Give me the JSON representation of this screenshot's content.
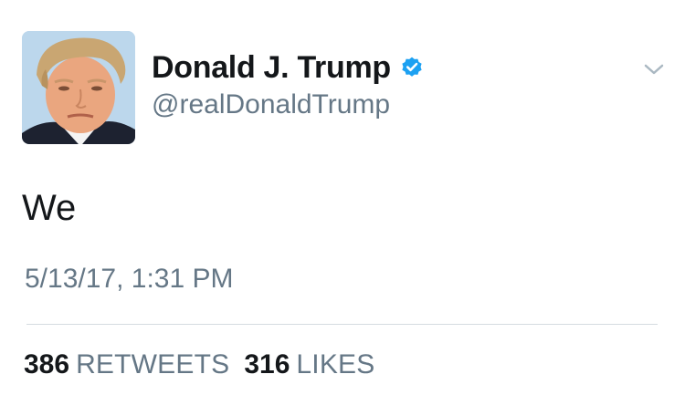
{
  "user": {
    "display_name": "Donald J. Trump",
    "handle": "@realDonaldTrump",
    "verified": true,
    "verified_color": "#1da1f2",
    "avatar_icon": "profile-photo",
    "avatar_background": "#bcd7ec"
  },
  "tweet": {
    "text": "We",
    "timestamp": "5/13/17, 1:31 PM"
  },
  "stats": {
    "retweets_count": "386",
    "retweets_label": "RETWEETS",
    "likes_count": "316",
    "likes_label": "LIKES"
  },
  "icons": {
    "verified": "verified-badge-icon",
    "menu": "chevron-down-icon"
  },
  "colors": {
    "primary_text": "#14171a",
    "secondary_text": "#657786",
    "divider": "#d5dbe0"
  }
}
